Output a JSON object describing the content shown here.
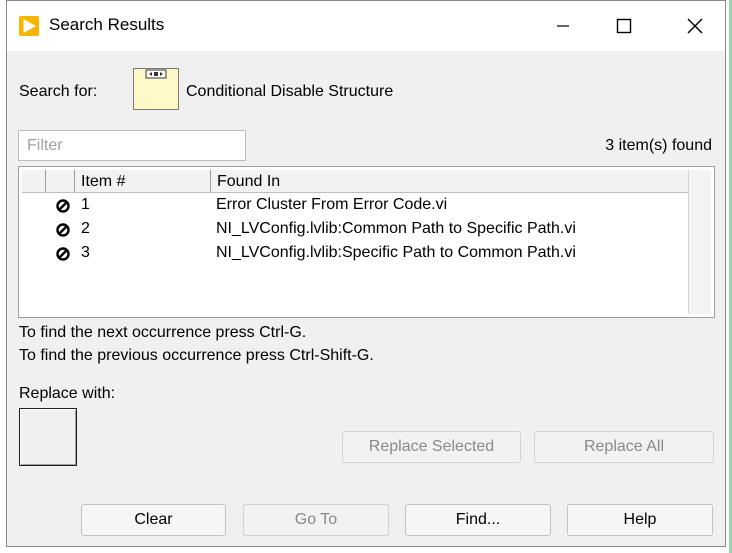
{
  "window": {
    "title": "Search Results"
  },
  "search": {
    "label": "Search for:",
    "target": "Conditional Disable Structure",
    "filter_placeholder": "Filter",
    "items_found": "3 item(s) found"
  },
  "table": {
    "headers": [
      "",
      "",
      "Item #",
      "Found In"
    ],
    "rows": [
      {
        "item": "1",
        "found_in": "Error Cluster From Error Code.vi"
      },
      {
        "item": "2",
        "found_in": "NI_LVConfig.lvlib:Common Path to Specific Path.vi"
      },
      {
        "item": "3",
        "found_in": "NI_LVConfig.lvlib:Specific Path to Common Path.vi"
      }
    ]
  },
  "hints": {
    "next": "To find the next occurrence press Ctrl-G.",
    "previous": "To find the previous occurrence press Ctrl-Shift-G."
  },
  "replace": {
    "label": "Replace with:",
    "selected_button": "Replace Selected",
    "all_button": "Replace All"
  },
  "buttons": {
    "clear": "Clear",
    "goto": "Go To",
    "find": "Find...",
    "help": "Help"
  }
}
